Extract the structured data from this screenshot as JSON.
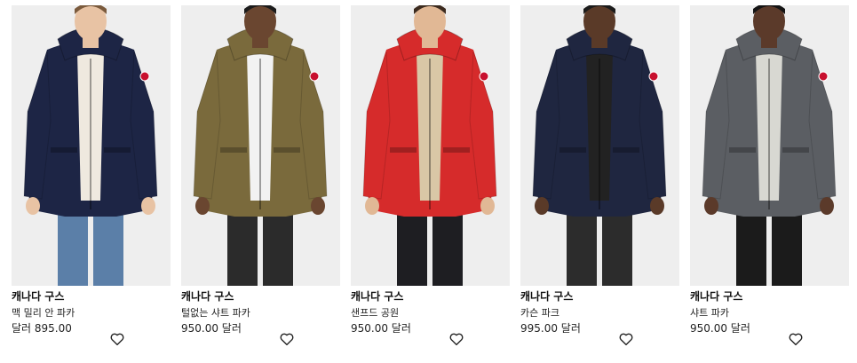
{
  "products": [
    {
      "brand": "캐나다 구스",
      "name": "맥 밀리 안 파카",
      "price": "달러 895.00",
      "jacket_color": "#1d2545",
      "inner_color": "#efe9df",
      "pants_color": "#5b7fa8",
      "skin": "#e8c3a4",
      "hair": "#7a5a3c",
      "image_icon": "product-photo-navy-parka"
    },
    {
      "brand": "캐나다 구스",
      "name": "털없는 샤트 파카",
      "price": "950.00 달러",
      "jacket_color": "#7a6a3c",
      "inner_color": "#f2f2f2",
      "pants_color": "#2b2b2b",
      "skin": "#6a4630",
      "hair": "#1b1b1b",
      "image_icon": "product-photo-khaki-parka"
    },
    {
      "brand": "캐나다 구스",
      "name": "샌프드 공원",
      "price": "950.00 달러",
      "jacket_color": "#d62b2b",
      "inner_color": "#d9c7a6",
      "pants_color": "#1e1e22",
      "skin": "#e1b895",
      "hair": "#3b2a1e",
      "image_icon": "product-photo-red-parka"
    },
    {
      "brand": "캐나다 구스",
      "name": "카슨 파크",
      "price": "995.00 달러",
      "jacket_color": "#1f2640",
      "inner_color": "#222222",
      "pants_color": "#2c2c2c",
      "skin": "#5a3a28",
      "hair": "#1b1b1b",
      "image_icon": "product-photo-navy-fur-parka"
    },
    {
      "brand": "캐나다 구스",
      "name": "샤트 파카",
      "price": "950.00 달러",
      "jacket_color": "#5b5e63",
      "inner_color": "#d8d8d2",
      "pants_color": "#1b1b1b",
      "skin": "#5b3a2a",
      "hair": "#141414",
      "image_icon": "product-photo-grey-parka"
    }
  ],
  "icons": {
    "favorite": "heart-outline-icon"
  }
}
